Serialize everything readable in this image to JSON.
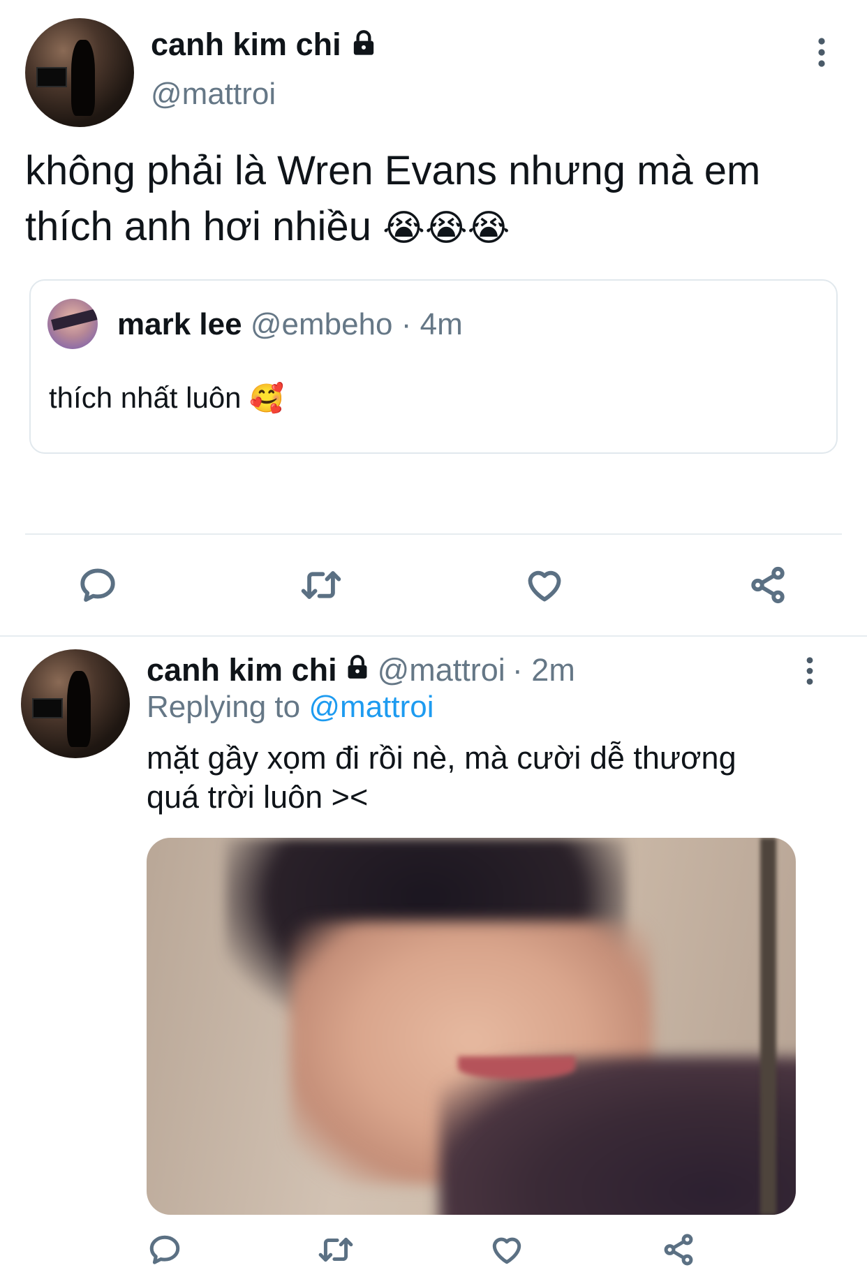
{
  "main_tweet": {
    "display_name": "canh kim chi",
    "handle": "@mattroi",
    "text_line1": "không phải là Wren Evans nhưng mà em",
    "text_line2": "thích anh hơi nhiều",
    "emojis": "😭😭😭",
    "quoted": {
      "display_name": "mark lee",
      "handle": "@embeho",
      "time": "· 4m",
      "text": "thích nhất luôn",
      "emoji": "🥰"
    }
  },
  "reply_tweet": {
    "display_name": "canh kim chi",
    "handle": "@mattroi",
    "time": "· 2m",
    "replying_label": "Replying to",
    "replying_handle": "@mattroi",
    "text_line1": "mặt gầy xọm đi rồi nè, mà cười dễ thương",
    "text_line2": "quá trời luôn ><"
  },
  "icons": {
    "more": "more-vertical-icon",
    "reply": "reply-icon",
    "retweet": "retweet-icon",
    "like": "heart-icon",
    "share": "share-icon",
    "lock": "lock-icon"
  },
  "colors": {
    "link": "#1d9bf0",
    "muted": "#657786",
    "icon": "#5b7083"
  }
}
